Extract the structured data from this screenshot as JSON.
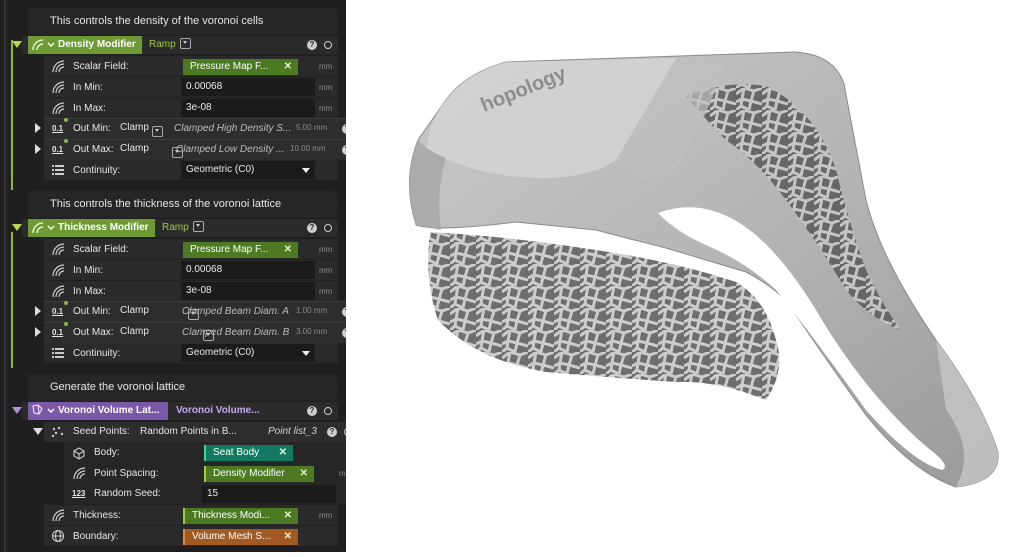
{
  "density": {
    "comment": "This controls the density of the voronoi cells",
    "name": "Density Modifier",
    "mode": "Ramp",
    "scalar_label": "Scalar Field:",
    "scalar_value": "Pressure Map F...",
    "inmin_label": "In Min:",
    "inmin_value": "0.00068",
    "inmax_label": "In Max:",
    "inmax_value": "3e-08",
    "outmin_label": "Out Min:",
    "outmin_mode": "Clamp",
    "outmin_value": "Clamped High Density S...",
    "outmin_amount": "5.00 mm",
    "outmax_label": "Out Max:",
    "outmax_mode": "Clamp",
    "outmax_value": "Clamped Low Density ...",
    "outmax_amount": "10.00 mm",
    "cont_label": "Continuity:",
    "cont_value": "Geometric (C0)"
  },
  "thickness": {
    "comment": "This controls the thickness of the voronoi lattice",
    "name": "Thickness Modifier",
    "mode": "Ramp",
    "scalar_label": "Scalar Field:",
    "scalar_value": "Pressure Map F...",
    "inmin_label": "In Min:",
    "inmin_value": "0.00068",
    "inmax_label": "In Max:",
    "inmax_value": "3e-08",
    "outmin_label": "Out Min:",
    "outmin_mode": "Clamp",
    "outmin_value": "Clamped Beam Diam. A",
    "outmin_amount": "1.00 mm",
    "outmax_label": "Out Max:",
    "outmax_mode": "Clamp",
    "outmax_value": "Clamped Beam Diam. B",
    "outmax_amount": "3.00 mm",
    "cont_label": "Continuity:",
    "cont_value": "Geometric (C0)"
  },
  "voronoi": {
    "comment": "Generate the voronoi lattice",
    "name": "Voronoi Volume Lat...",
    "mode": "Voronoi Volume...",
    "seed_label": "Seed Points:",
    "seed_value": "Random Points in B...",
    "seed_out": "Point list_3",
    "body_label": "Body:",
    "body_value": "Seat Body",
    "spacing_label": "Point Spacing:",
    "spacing_value": "Density Modifier",
    "random_label": "Random Seed:",
    "random_value": "15",
    "thick_label": "Thickness:",
    "thick_value": "Thickness Modi...",
    "boundary_label": "Boundary:",
    "boundary_value": "Volume Mesh S..."
  },
  "common": {
    "unit": "mm",
    "help": "?",
    "x": "✕",
    "num_icon": "0.1",
    "int_icon": "123"
  },
  "viewport": {
    "logo_text": "hopology"
  },
  "colors": {
    "modifier_green": "#6e9a34",
    "chip_green": "#4c7a22",
    "voronoi_purple": "#7a5aa6",
    "chip_teal": "#127a62",
    "chip_orange": "#a05a22"
  }
}
